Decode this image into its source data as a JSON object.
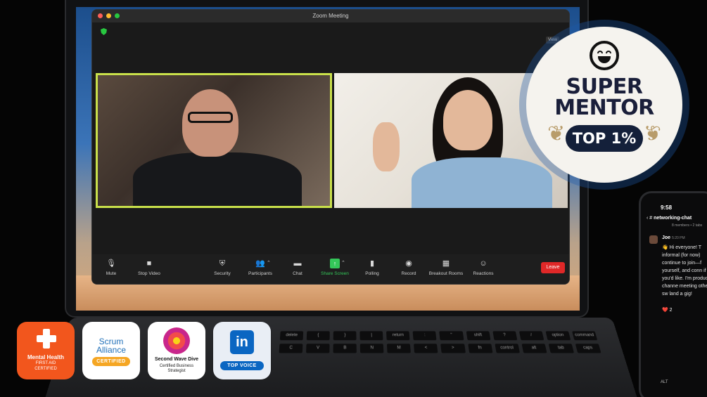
{
  "zoom": {
    "window_title": "Zoom Meeting",
    "view_label": "View",
    "toolbar": [
      {
        "label": "Mute",
        "icon": "microphone-icon"
      },
      {
        "label": "Stop Video",
        "icon": "video-camera-icon"
      },
      {
        "label": "Security",
        "icon": "shield-icon"
      },
      {
        "label": "Participants",
        "icon": "participants-icon"
      },
      {
        "label": "Chat",
        "icon": "chat-bubble-icon"
      },
      {
        "label": "Share Screen",
        "icon": "share-screen-icon"
      },
      {
        "label": "Polling",
        "icon": "bar-chart-icon"
      },
      {
        "label": "Record",
        "icon": "record-icon"
      },
      {
        "label": "Breakout Rooms",
        "icon": "grid-icon"
      },
      {
        "label": "Reactions",
        "icon": "emoji-icon"
      }
    ],
    "leave_label": "Leave",
    "active_speaker_color": "#c9e04a",
    "share_color": "#34c759",
    "leave_color": "#e02828"
  },
  "badge": {
    "line1": "SUPER",
    "line2": "MENTOR",
    "pill": "TOP 1%"
  },
  "phone": {
    "time": "9:58",
    "channel": "networking-chat",
    "channel_sub": "8 members • 2 tabs",
    "user": "Joe",
    "msg_time": "5:20 PM",
    "message": "👋 Hi everyone! T informal (for now) continue to join—f yourself, and conn if you'd like. I'm productive channe meeting others, sw land a gig!",
    "reaction": "❤️ 2",
    "alt_label": "ALT"
  },
  "certs": {
    "mhfa": {
      "l1": "Mental Health",
      "l2": "FIRST AID",
      "l3": "CERTIFIED"
    },
    "scrum": {
      "name": "Scrum Alliance",
      "tag": "CERTIFIED"
    },
    "swd": {
      "l1": "Second Wave Dive",
      "l2": "Certified Business",
      "l3": "Strategist"
    },
    "linkedin": {
      "logo": "in",
      "tag": "TOP VOICE"
    }
  },
  "keyboard_keys": [
    "delete",
    "{",
    "}",
    "|",
    "return",
    ":",
    "\"",
    "shift",
    "?",
    "/",
    "option",
    "command",
    "C",
    "V",
    "B",
    "N",
    "M",
    "<",
    ">",
    "fn",
    "control",
    "alt",
    "tab",
    "caps"
  ]
}
